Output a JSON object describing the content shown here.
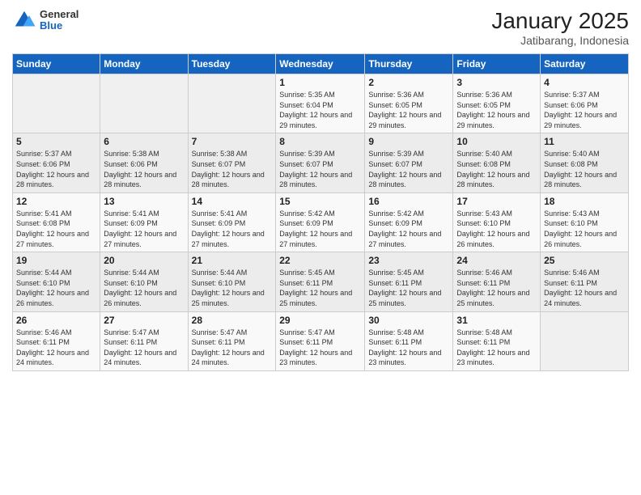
{
  "header": {
    "logo_general": "General",
    "logo_blue": "Blue",
    "title": "January 2025",
    "subtitle": "Jatibarang, Indonesia"
  },
  "weekdays": [
    "Sunday",
    "Monday",
    "Tuesday",
    "Wednesday",
    "Thursday",
    "Friday",
    "Saturday"
  ],
  "weeks": [
    [
      {
        "day": "",
        "info": ""
      },
      {
        "day": "",
        "info": ""
      },
      {
        "day": "",
        "info": ""
      },
      {
        "day": "1",
        "info": "Sunrise: 5:35 AM\nSunset: 6:04 PM\nDaylight: 12 hours and 29 minutes."
      },
      {
        "day": "2",
        "info": "Sunrise: 5:36 AM\nSunset: 6:05 PM\nDaylight: 12 hours and 29 minutes."
      },
      {
        "day": "3",
        "info": "Sunrise: 5:36 AM\nSunset: 6:05 PM\nDaylight: 12 hours and 29 minutes."
      },
      {
        "day": "4",
        "info": "Sunrise: 5:37 AM\nSunset: 6:06 PM\nDaylight: 12 hours and 29 minutes."
      }
    ],
    [
      {
        "day": "5",
        "info": "Sunrise: 5:37 AM\nSunset: 6:06 PM\nDaylight: 12 hours and 28 minutes."
      },
      {
        "day": "6",
        "info": "Sunrise: 5:38 AM\nSunset: 6:06 PM\nDaylight: 12 hours and 28 minutes."
      },
      {
        "day": "7",
        "info": "Sunrise: 5:38 AM\nSunset: 6:07 PM\nDaylight: 12 hours and 28 minutes."
      },
      {
        "day": "8",
        "info": "Sunrise: 5:39 AM\nSunset: 6:07 PM\nDaylight: 12 hours and 28 minutes."
      },
      {
        "day": "9",
        "info": "Sunrise: 5:39 AM\nSunset: 6:07 PM\nDaylight: 12 hours and 28 minutes."
      },
      {
        "day": "10",
        "info": "Sunrise: 5:40 AM\nSunset: 6:08 PM\nDaylight: 12 hours and 28 minutes."
      },
      {
        "day": "11",
        "info": "Sunrise: 5:40 AM\nSunset: 6:08 PM\nDaylight: 12 hours and 28 minutes."
      }
    ],
    [
      {
        "day": "12",
        "info": "Sunrise: 5:41 AM\nSunset: 6:08 PM\nDaylight: 12 hours and 27 minutes."
      },
      {
        "day": "13",
        "info": "Sunrise: 5:41 AM\nSunset: 6:09 PM\nDaylight: 12 hours and 27 minutes."
      },
      {
        "day": "14",
        "info": "Sunrise: 5:41 AM\nSunset: 6:09 PM\nDaylight: 12 hours and 27 minutes."
      },
      {
        "day": "15",
        "info": "Sunrise: 5:42 AM\nSunset: 6:09 PM\nDaylight: 12 hours and 27 minutes."
      },
      {
        "day": "16",
        "info": "Sunrise: 5:42 AM\nSunset: 6:09 PM\nDaylight: 12 hours and 27 minutes."
      },
      {
        "day": "17",
        "info": "Sunrise: 5:43 AM\nSunset: 6:10 PM\nDaylight: 12 hours and 26 minutes."
      },
      {
        "day": "18",
        "info": "Sunrise: 5:43 AM\nSunset: 6:10 PM\nDaylight: 12 hours and 26 minutes."
      }
    ],
    [
      {
        "day": "19",
        "info": "Sunrise: 5:44 AM\nSunset: 6:10 PM\nDaylight: 12 hours and 26 minutes."
      },
      {
        "day": "20",
        "info": "Sunrise: 5:44 AM\nSunset: 6:10 PM\nDaylight: 12 hours and 26 minutes."
      },
      {
        "day": "21",
        "info": "Sunrise: 5:44 AM\nSunset: 6:10 PM\nDaylight: 12 hours and 25 minutes."
      },
      {
        "day": "22",
        "info": "Sunrise: 5:45 AM\nSunset: 6:11 PM\nDaylight: 12 hours and 25 minutes."
      },
      {
        "day": "23",
        "info": "Sunrise: 5:45 AM\nSunset: 6:11 PM\nDaylight: 12 hours and 25 minutes."
      },
      {
        "day": "24",
        "info": "Sunrise: 5:46 AM\nSunset: 6:11 PM\nDaylight: 12 hours and 25 minutes."
      },
      {
        "day": "25",
        "info": "Sunrise: 5:46 AM\nSunset: 6:11 PM\nDaylight: 12 hours and 24 minutes."
      }
    ],
    [
      {
        "day": "26",
        "info": "Sunrise: 5:46 AM\nSunset: 6:11 PM\nDaylight: 12 hours and 24 minutes."
      },
      {
        "day": "27",
        "info": "Sunrise: 5:47 AM\nSunset: 6:11 PM\nDaylight: 12 hours and 24 minutes."
      },
      {
        "day": "28",
        "info": "Sunrise: 5:47 AM\nSunset: 6:11 PM\nDaylight: 12 hours and 24 minutes."
      },
      {
        "day": "29",
        "info": "Sunrise: 5:47 AM\nSunset: 6:11 PM\nDaylight: 12 hours and 23 minutes."
      },
      {
        "day": "30",
        "info": "Sunrise: 5:48 AM\nSunset: 6:11 PM\nDaylight: 12 hours and 23 minutes."
      },
      {
        "day": "31",
        "info": "Sunrise: 5:48 AM\nSunset: 6:11 PM\nDaylight: 12 hours and 23 minutes."
      },
      {
        "day": "",
        "info": ""
      }
    ]
  ]
}
